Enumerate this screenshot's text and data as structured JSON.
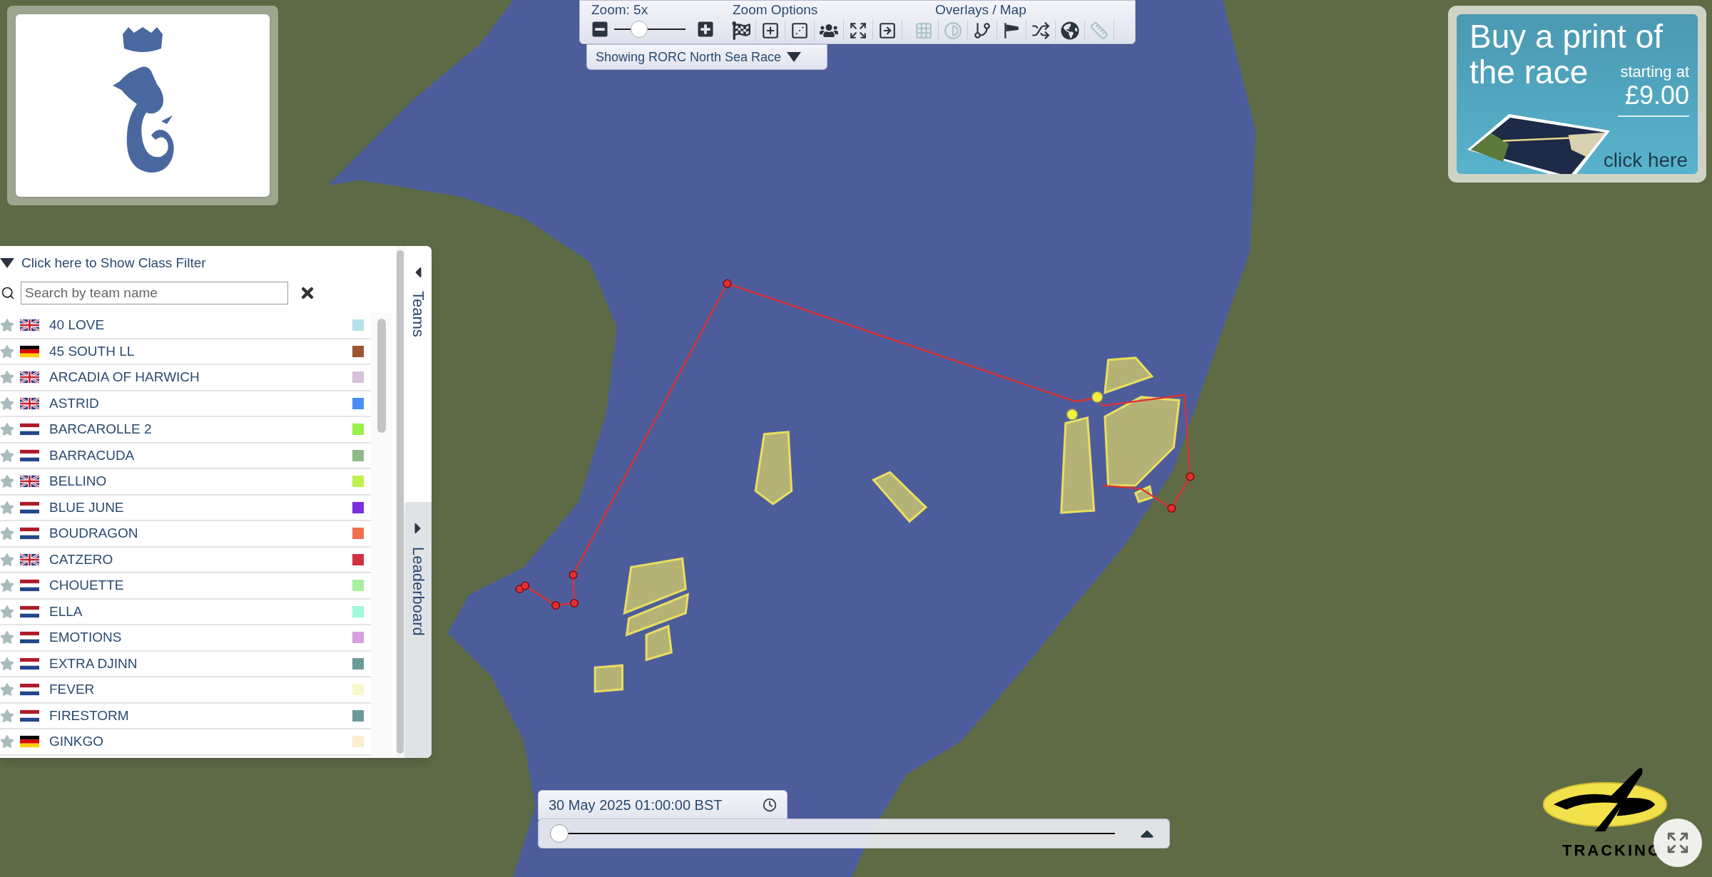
{
  "toolbar": {
    "zoom_label": "Zoom: 5x",
    "zoom_slider": {
      "level": 0.35
    },
    "zoom_options_label": "Zoom Options",
    "zoom_options": [
      {
        "kind": "finish"
      },
      {
        "kind": "zoom-in"
      },
      {
        "kind": "dice"
      },
      {
        "kind": "fleet"
      },
      {
        "kind": "fit"
      },
      {
        "kind": "next"
      }
    ],
    "overlays_label": "Overlays / Map",
    "overlays": [
      {
        "kind": "grid",
        "active": false
      },
      {
        "kind": "contrast",
        "active": false
      },
      {
        "kind": "branch",
        "active": true
      },
      {
        "kind": "windsock",
        "active": true
      },
      {
        "kind": "shuffle",
        "active": true
      },
      {
        "kind": "globe",
        "active": true
      },
      {
        "kind": "ruler",
        "active": false
      }
    ]
  },
  "race_selector": {
    "label": "Showing RORC North Sea Race"
  },
  "team_panel": {
    "class_filter": "Click here to Show Class Filter",
    "search": {
      "placeholder": "Search by team name"
    },
    "teams": [
      {
        "name": "40 LOVE",
        "kind": "gb",
        "color": "#b8e0e8",
        "favorite": false
      },
      {
        "name": "45 SOUTH LL",
        "kind": "de",
        "color": "#9b5530",
        "favorite": false
      },
      {
        "name": "ARCADIA OF HARWICH",
        "kind": "gb",
        "color": "#d7c0dc",
        "favorite": false
      },
      {
        "name": "ASTRID",
        "kind": "gb",
        "color": "#4a8ef5",
        "favorite": false
      },
      {
        "name": "BARCAROLLE 2",
        "kind": "nl",
        "color": "#98f048",
        "favorite": false
      },
      {
        "name": "BARRACUDA",
        "kind": "nl",
        "color": "#90b88a",
        "favorite": false
      },
      {
        "name": "BELLINO",
        "kind": "gb",
        "color": "#bef050",
        "favorite": false
      },
      {
        "name": "BLUE JUNE",
        "kind": "nl",
        "color": "#7b2fe0",
        "favorite": false
      },
      {
        "name": "BOUDRAGON",
        "kind": "nl",
        "color": "#f07050",
        "favorite": false
      },
      {
        "name": "CATZERO",
        "kind": "gb",
        "color": "#d03040",
        "favorite": false
      },
      {
        "name": "CHOUETTE",
        "kind": "nl",
        "color": "#a8f0a0",
        "favorite": false
      },
      {
        "name": "ELLA",
        "kind": "nl",
        "color": "#a0f8d8",
        "favorite": false
      },
      {
        "name": "EMOTIONS",
        "kind": "nl",
        "color": "#d8a0e0",
        "favorite": false
      },
      {
        "name": "EXTRA DJINN",
        "kind": "nl",
        "color": "#6b9a98",
        "favorite": false
      },
      {
        "name": "FEVER",
        "kind": "nl",
        "color": "#f8f8d0",
        "favorite": false
      },
      {
        "name": "FIRESTORM",
        "kind": "nl",
        "color": "#6b9a99",
        "favorite": false
      },
      {
        "name": "GINKGO",
        "kind": "de",
        "color": "#fcecd0",
        "favorite": false
      }
    ],
    "tabs": [
      {
        "label": "Teams",
        "selected": true
      },
      {
        "label": "Leaderboard",
        "selected": false
      }
    ]
  },
  "ad": {
    "headline": [
      "Buy a print of",
      "the race"
    ],
    "price_label": "starting at",
    "price": "£9.00",
    "cta": "click here"
  },
  "timeline": {
    "datetime": "30 May 2025 01:00:00 BST",
    "slider": {
      "level": 0
    }
  },
  "brand": {
    "wordmark": "TRACKING"
  }
}
